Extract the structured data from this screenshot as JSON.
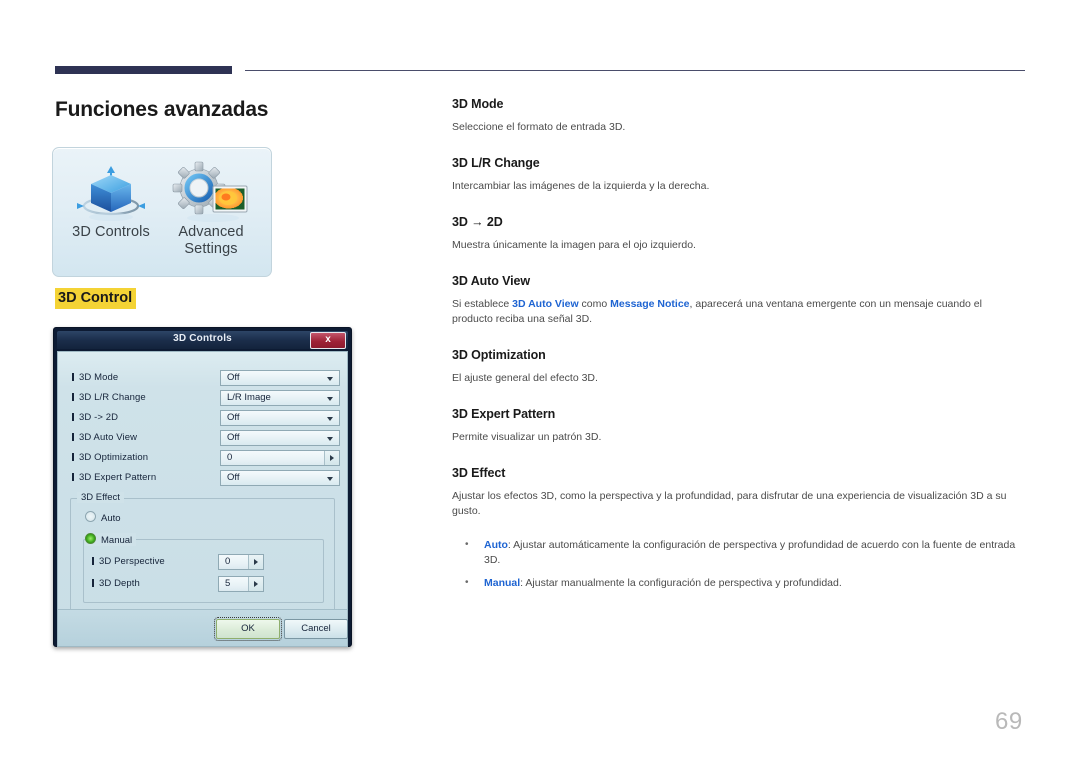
{
  "page": {
    "title": "Funciones avanzadas",
    "number": "69",
    "section_tag": "3D Control"
  },
  "icon_panel": {
    "tiles": [
      {
        "caption": "3D Controls",
        "icon": "3d-cube-icon"
      },
      {
        "caption": "Advanced\nSettings",
        "icon": "gear-picture-icon"
      }
    ]
  },
  "dialog": {
    "title": "3D Controls",
    "close_label": "x",
    "rows": [
      {
        "label": "3D Mode",
        "value": "Off",
        "control": "dropdown"
      },
      {
        "label": "3D L/R Change",
        "value": "L/R Image",
        "control": "dropdown"
      },
      {
        "label": "3D -> 2D",
        "value": "Off",
        "control": "dropdown"
      },
      {
        "label": "3D Auto View",
        "value": "Off",
        "control": "dropdown"
      },
      {
        "label": "3D Optimization",
        "value": "0",
        "control": "stepper"
      },
      {
        "label": "3D Expert Pattern",
        "value": "Off",
        "control": "dropdown"
      }
    ],
    "effect_group": {
      "legend": "3D Effect",
      "auto_label": "Auto",
      "auto_selected": false,
      "manual_label": "Manual",
      "manual_selected": true,
      "manual_rows": [
        {
          "label": "3D Perspective",
          "value": "0"
        },
        {
          "label": "3D Depth",
          "value": "5"
        }
      ]
    },
    "buttons": {
      "ok": "OK",
      "cancel": "Cancel"
    }
  },
  "content": {
    "sections": [
      {
        "heading": "3D Mode",
        "body": "Seleccione el formato de entrada 3D."
      },
      {
        "heading": "3D L/R Change",
        "body": "Intercambiar las imágenes de la izquierda y la derecha."
      },
      {
        "heading": "3D → 2D",
        "body": "Muestra únicamente la imagen para el ojo izquierdo."
      },
      {
        "heading": "3D Auto View",
        "body_parts": {
          "p1": "Si establece ",
          "link1": "3D Auto View",
          "p2": " como ",
          "link2": "Message Notice",
          "p3": ", aparecerá una ventana emergente con un mensaje cuando el producto reciba una señal 3D."
        }
      },
      {
        "heading": "3D Optimization",
        "body": "El ajuste general del efecto 3D."
      },
      {
        "heading": "3D Expert Pattern",
        "body": "Permite visualizar un patrón 3D."
      },
      {
        "heading": "3D Effect",
        "body": "Ajustar los efectos 3D, como la perspectiva y la profundidad, para disfrutar de una experiencia de visualización 3D a su gusto.",
        "bullets": [
          {
            "term": "Auto",
            "text": ": Ajustar automáticamente la configuración de perspectiva y profundidad de acuerdo con la fuente de entrada 3D."
          },
          {
            "term": "Manual",
            "text": ": Ajustar manualmente la configuración de perspectiva y profundidad."
          }
        ]
      }
    ]
  },
  "colors": {
    "rule_navy": "#2e3254",
    "highlight_yellow": "#f4d335",
    "link_blue": "#1e64d2",
    "dialog_navy": "#0d1b33",
    "close_red": "#9e2237"
  }
}
